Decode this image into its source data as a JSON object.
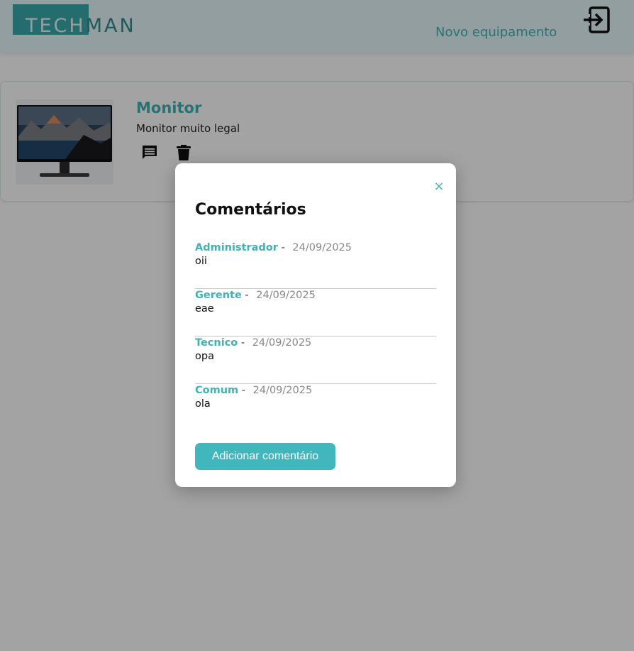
{
  "header": {
    "logo_part1": "TECH",
    "logo_part2": "MAN",
    "new_equipment_link": "Novo equipamento",
    "logout_icon": "logout-icon"
  },
  "equipment": {
    "title": "Monitor",
    "description": "Monitor muito legal",
    "image": "monitor-image",
    "actions": [
      "comment-icon",
      "trash-icon"
    ]
  },
  "modal": {
    "title": "Comentários",
    "close_label": "×",
    "comments": [
      {
        "author": "Administrador",
        "separator": "-",
        "date": "24/09/2025",
        "text": "oii"
      },
      {
        "author": "Gerente",
        "separator": "-",
        "date": "24/09/2025",
        "text": "eae"
      },
      {
        "author": "Tecnico",
        "separator": "-",
        "date": "24/09/2025",
        "text": "opa"
      },
      {
        "author": "Comum",
        "separator": "-",
        "date": "24/09/2025",
        "text": "ola"
      }
    ],
    "add_button_label": "Adicionar comentário"
  },
  "colors": {
    "accent": "#41b7bd",
    "logo_box": "#3aa9ad",
    "header_bg": "#e6f8fb",
    "overlay": "rgba(0,0,0,0.36)"
  }
}
